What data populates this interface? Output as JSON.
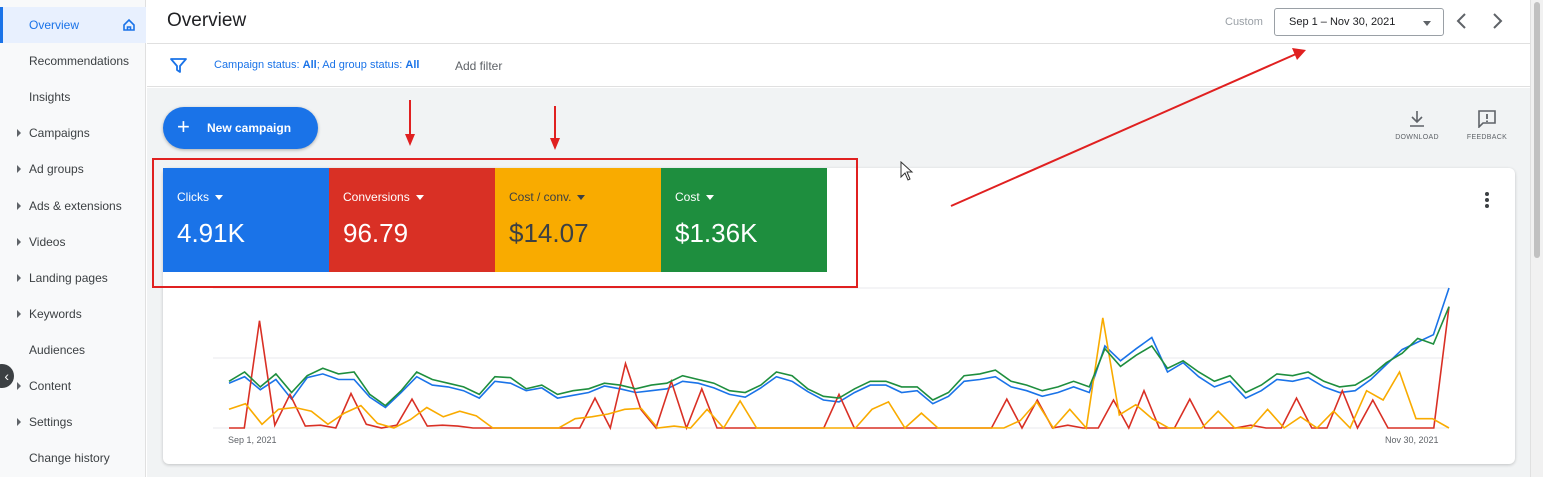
{
  "sidebar": {
    "items": [
      {
        "label": "Overview",
        "active": true,
        "expandable": false
      },
      {
        "label": "Recommendations",
        "active": false,
        "expandable": false
      },
      {
        "label": "Insights",
        "active": false,
        "expandable": false
      },
      {
        "label": "Campaigns",
        "active": false,
        "expandable": true
      },
      {
        "label": "Ad groups",
        "active": false,
        "expandable": true
      },
      {
        "label": "Ads & extensions",
        "active": false,
        "expandable": true
      },
      {
        "label": "Videos",
        "active": false,
        "expandable": true
      },
      {
        "label": "Landing pages",
        "active": false,
        "expandable": true
      },
      {
        "label": "Keywords",
        "active": false,
        "expandable": true
      },
      {
        "label": "Audiences",
        "active": false,
        "expandable": false
      },
      {
        "label": "Content",
        "active": false,
        "expandable": true
      },
      {
        "label": "Settings",
        "active": false,
        "expandable": true
      },
      {
        "label": "Change history",
        "active": false,
        "expandable": false
      }
    ],
    "collapse_icon": "chevron-left-icon"
  },
  "header": {
    "title": "Overview",
    "custom_label": "Custom",
    "date_range": "Sep 1 – Nov 30, 2021"
  },
  "filters": {
    "campaign_status_label": "Campaign status:",
    "campaign_status_value": "All",
    "separator": ";",
    "ad_group_status_label": "Ad group status:",
    "ad_group_status_value": "All",
    "add_filter": "Add filter"
  },
  "actions": {
    "new_campaign": "New campaign",
    "download": "DOWNLOAD",
    "feedback": "FEEDBACK"
  },
  "colors": {
    "clicks": "#1a73e8",
    "conversions": "#d93025",
    "cost_per_conv": "#f9ab00",
    "cost": "#1e8e3e",
    "annotation": "#e02020"
  },
  "metrics": [
    {
      "label": "Clicks",
      "value": "4.91K",
      "color": "#1a73e8"
    },
    {
      "label": "Conversions",
      "value": "96.79",
      "color": "#d93025"
    },
    {
      "label": "Cost / conv.",
      "value": "$14.07",
      "color": "#f9ab00"
    },
    {
      "label": "Cost",
      "value": "$1.36K",
      "color": "#1e8e3e"
    }
  ],
  "chart_data": {
    "type": "line",
    "x_start": "Sep 1, 2021",
    "x_end": "Nov 30, 2021",
    "series": [
      {
        "name": "Clicks",
        "color": "#1a73e8",
        "values": [
          48,
          55,
          41,
          52,
          31,
          54,
          58,
          52,
          52,
          33,
          22,
          38,
          55,
          46,
          44,
          40,
          32,
          50,
          48,
          40,
          43,
          32,
          35,
          38,
          45,
          42,
          38,
          40,
          42,
          50,
          48,
          43,
          36,
          33,
          43,
          55,
          50,
          39,
          30,
          28,
          38,
          46,
          46,
          38,
          40,
          26,
          34,
          50,
          52,
          55,
          44,
          40,
          34,
          38,
          44,
          38,
          88,
          72,
          85,
          97,
          60,
          70,
          55,
          44,
          50,
          32,
          40,
          52,
          50,
          54,
          44,
          38,
          40,
          52,
          68,
          84,
          92,
          100,
          150
        ]
      },
      {
        "name": "Conversions",
        "color": "#d93025",
        "values": [
          0,
          0,
          115,
          3,
          36,
          2,
          3,
          0,
          37,
          4,
          0,
          3,
          31,
          2,
          3,
          2,
          0,
          0,
          0,
          0,
          0,
          0,
          0,
          0,
          32,
          0,
          69,
          20,
          0,
          50,
          0,
          42,
          0,
          0,
          0,
          0,
          0,
          0,
          0,
          0,
          36,
          0,
          0,
          0,
          0,
          0,
          0,
          0,
          0,
          0,
          0,
          31,
          0,
          30,
          0,
          3,
          0,
          0,
          30,
          0,
          40,
          0,
          0,
          31,
          0,
          0,
          0,
          3,
          0,
          0,
          32,
          0,
          0,
          40,
          0,
          30,
          0,
          0,
          0,
          0,
          130
        ]
      },
      {
        "name": "Cost / conv.",
        "color": "#f9ab00",
        "values": [
          20,
          26,
          4,
          20,
          22,
          18,
          4,
          16,
          24,
          5,
          0,
          9,
          22,
          12,
          18,
          13,
          0,
          0,
          0,
          0,
          0,
          10,
          12,
          15,
          20,
          21,
          0,
          2,
          0,
          20,
          0,
          29,
          0,
          0,
          0,
          0,
          0,
          0,
          0,
          20,
          28,
          0,
          16,
          0,
          0,
          0,
          0,
          0,
          8,
          28,
          0,
          20,
          0,
          118,
          14,
          25,
          10,
          0,
          0,
          0,
          18,
          0,
          0,
          20,
          0,
          12,
          0,
          18,
          0,
          40,
          30,
          60,
          10,
          10,
          0
        ]
      },
      {
        "name": "Cost",
        "color": "#1e8e3e",
        "values": [
          50,
          60,
          44,
          58,
          38,
          56,
          64,
          58,
          60,
          36,
          24,
          40,
          60,
          52,
          48,
          44,
          36,
          55,
          54,
          42,
          46,
          36,
          40,
          42,
          48,
          46,
          42,
          46,
          48,
          56,
          52,
          48,
          40,
          38,
          46,
          60,
          56,
          42,
          34,
          32,
          42,
          50,
          50,
          44,
          44,
          30,
          38,
          56,
          58,
          62,
          50,
          46,
          40,
          44,
          50,
          44,
          85,
          66,
          78,
          88,
          64,
          72,
          60,
          50,
          56,
          38,
          46,
          58,
          56,
          60,
          50,
          44,
          46,
          56,
          70,
          80,
          96,
          90,
          130
        ]
      }
    ]
  },
  "annotations": {
    "arrows": 3,
    "highlight": "metric tiles"
  }
}
